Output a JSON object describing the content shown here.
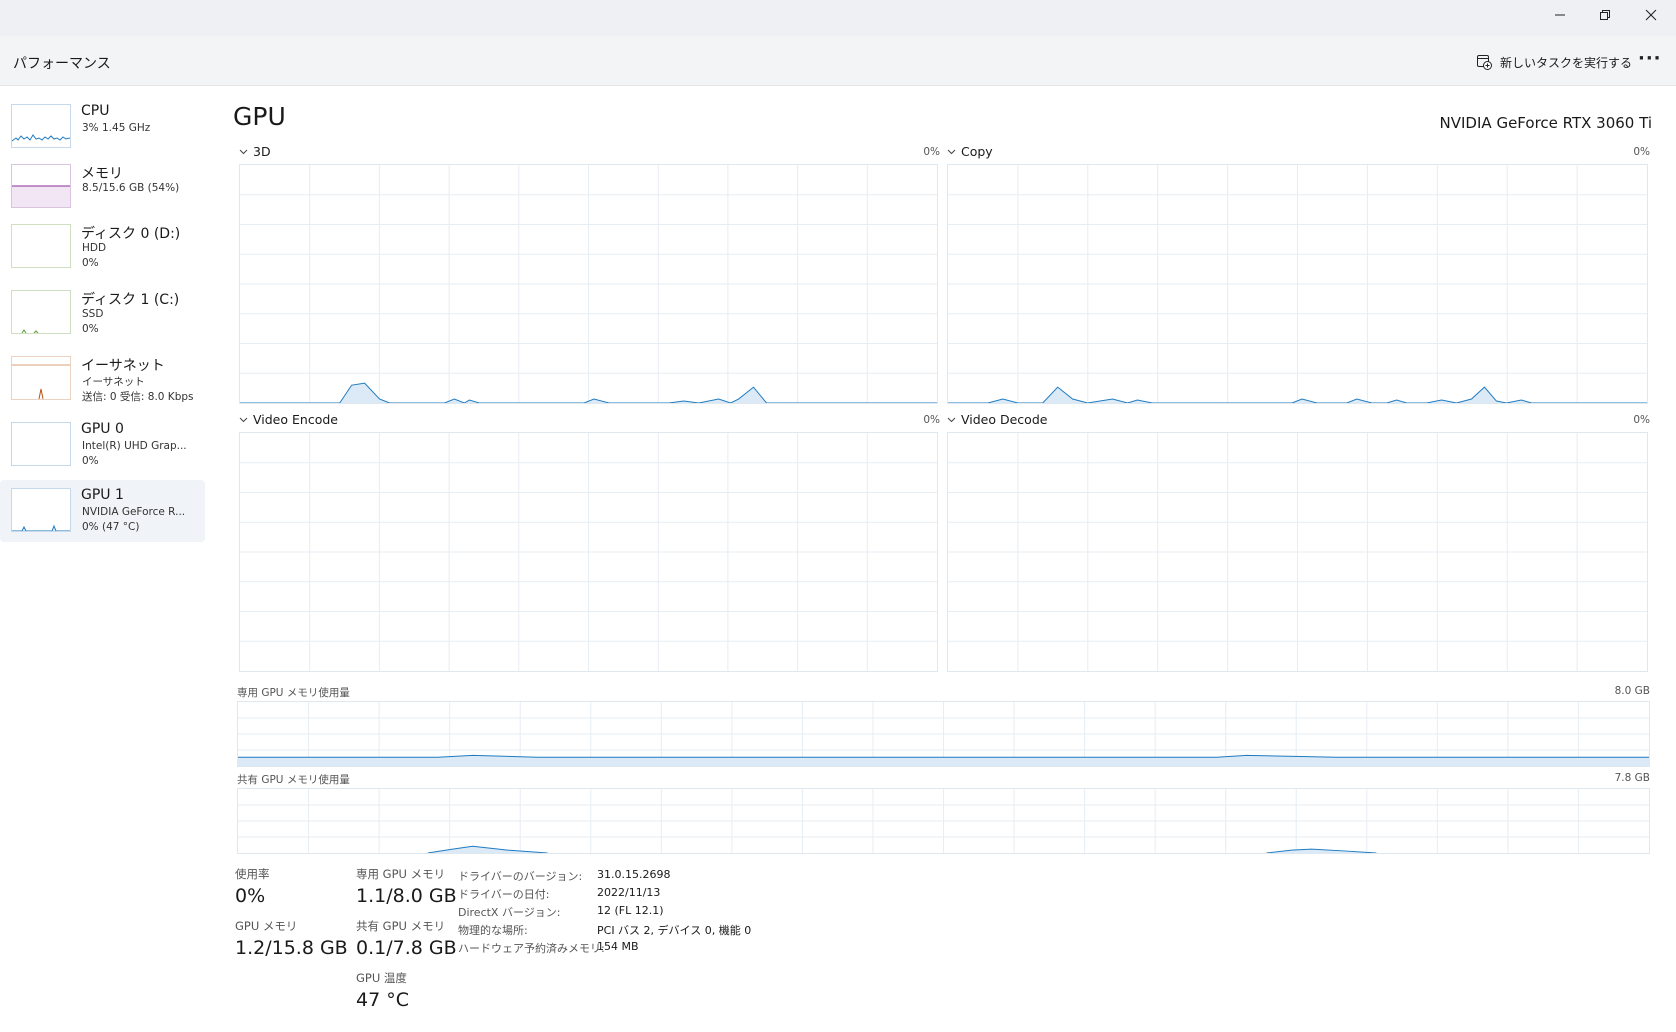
{
  "window": {
    "minimize_label": "minimize",
    "restore_label": "restore",
    "close_label": "close"
  },
  "header": {
    "title": "パフォーマンス",
    "run_task_label": "新しいタスクを実行する",
    "more_label": "···"
  },
  "sidebar": {
    "items": [
      {
        "name": "CPU",
        "lines": [
          "3%  1.45 GHz"
        ],
        "color": "#1f7bc1"
      },
      {
        "name": "メモリ",
        "lines": [
          "8.5/15.6 GB (54%)"
        ],
        "color": "#8b2c9c"
      },
      {
        "name": "ディスク 0 (D:)",
        "lines": [
          "HDD",
          "0%"
        ],
        "color": "#5c9c2c"
      },
      {
        "name": "ディスク 1 (C:)",
        "lines": [
          "SSD",
          "0%"
        ],
        "color": "#5c9c2c"
      },
      {
        "name": "イーサネット",
        "lines": [
          "イーサネット",
          "送信: 0 受信: 8.0 Kbps"
        ],
        "color": "#b5571a"
      },
      {
        "name": "GPU 0",
        "lines": [
          "Intel(R) UHD Grap...",
          "0%"
        ],
        "color": "#1f7bc1"
      },
      {
        "name": "GPU 1",
        "lines": [
          "NVIDIA GeForce R...",
          "0%  (47 °C)"
        ],
        "color": "#1f7bc1"
      }
    ],
    "selected_index": 6
  },
  "main": {
    "title": "GPU",
    "gpu_name": "NVIDIA GeForce RTX 3060 Ti",
    "graphs": {
      "g3d": {
        "label": "3D",
        "pct": "0%"
      },
      "copy": {
        "label": "Copy",
        "pct": "0%"
      },
      "encode": {
        "label": "Video Encode",
        "pct": "0%"
      },
      "decode": {
        "label": "Video Decode",
        "pct": "0%"
      }
    },
    "dedicated_mem": {
      "label": "専用 GPU メモリ使用量",
      "max": "8.0 GB"
    },
    "shared_mem": {
      "label": "共有 GPU メモリ使用量",
      "max": "7.8 GB"
    },
    "line_color": "#1f7bc1",
    "fill_color": "#dbeaf6",
    "grid_color": "#e6edf3"
  },
  "stats": {
    "usage": {
      "label": "使用率",
      "value": "0%"
    },
    "gpu_memory": {
      "label": "GPU メモリ",
      "value": "1.2/15.8 GB"
    },
    "dedicated": {
      "label": "専用 GPU メモリ",
      "value": "1.1/8.0 GB"
    },
    "shared": {
      "label": "共有 GPU メモリ",
      "value": "0.1/7.8 GB"
    },
    "temp": {
      "label": "GPU 温度",
      "value": "47 °C"
    },
    "info": [
      {
        "key": "ドライバーのバージョン:",
        "value": "31.0.15.2698"
      },
      {
        "key": "ドライバーの日付:",
        "value": "2022/11/13"
      },
      {
        "key": "DirectX バージョン:",
        "value": "12 (FL 12.1)"
      },
      {
        "key": "物理的な場所:",
        "value": "PCI バス 2, デバイス 0, 機能 0"
      },
      {
        "key": "ハードウェア予約済みメモリ:",
        "value": "154 MB"
      }
    ]
  }
}
